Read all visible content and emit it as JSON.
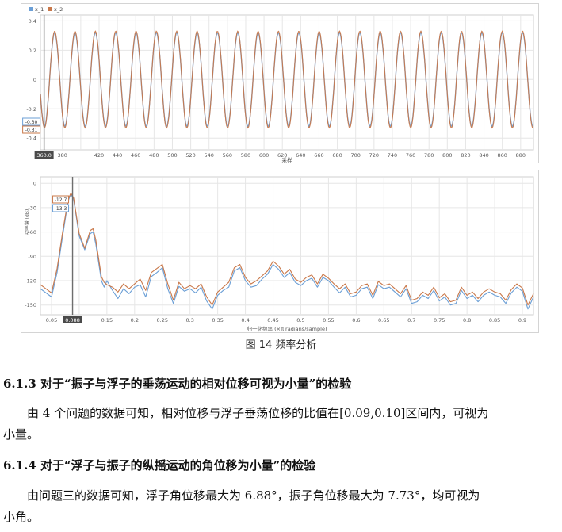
{
  "figure": {
    "caption": "图 14  频率分析",
    "colors": {
      "x_1": "#6b9fd6",
      "x_2": "#c9784a",
      "grid": "#e6e6e6",
      "cursor": "#6e6e6e",
      "cursorTag": "#4a4a4a"
    },
    "time_panel": {
      "legend": [
        "x_1",
        "x_2"
      ],
      "xlabel": "采样",
      "cursor_label": "360.0",
      "markers": [
        "-0.30",
        "-0.31"
      ]
    },
    "freq_panel": {
      "ylabel": "功率谱 (dB)",
      "xlabel": "归一化频率 (×π radians/sample)",
      "cursor_label": "0.088",
      "markers": [
        "-12.7",
        "-13.3"
      ]
    }
  },
  "chart_data": [
    {
      "type": "line",
      "title": "",
      "xlabel": "采样",
      "ylabel": "",
      "xlim": [
        356,
        894
      ],
      "ylim": [
        -0.48,
        0.44
      ],
      "x_ticks": [
        360,
        380,
        400,
        420,
        440,
        460,
        480,
        500,
        520,
        540,
        560,
        580,
        600,
        620,
        640,
        660,
        680,
        700,
        720,
        740,
        760,
        780,
        800,
        820,
        840,
        860,
        880
      ],
      "x_tick_labels": [
        "360",
        "380",
        "",
        "420",
        "440",
        "460",
        "480",
        "500",
        "520",
        "540",
        "560",
        "580",
        "600",
        "620",
        "640",
        "660",
        "680",
        "700",
        "720",
        "740",
        "760",
        "780",
        "800",
        "820",
        "840",
        "860",
        "880"
      ],
      "y_ticks": [
        -0.4,
        -0.2,
        0,
        0.2,
        0.4
      ],
      "y_tick_labels": [
        "-0.4",
        "-0.2",
        "0",
        "0.2",
        "0.4"
      ],
      "series": [
        {
          "name": "x_1",
          "period": 22.2,
          "amplitude": 0.32,
          "phase_zero_at": 366
        },
        {
          "name": "x_2",
          "period": 22.2,
          "amplitude": 0.33,
          "phase_zero_at": 366
        }
      ],
      "cursor_x": 360,
      "legend": "top-left",
      "grid": true
    },
    {
      "type": "line",
      "title": "",
      "xlabel": "归一化频率 (×π radians/sample)",
      "ylabel": "功率谱 (dB)",
      "xlim": [
        0.03,
        0.92
      ],
      "ylim": [
        -162,
        8
      ],
      "x_ticks": [
        0.05,
        0.1,
        0.15,
        0.2,
        0.25,
        0.3,
        0.35,
        0.4,
        0.45,
        0.5,
        0.55,
        0.6,
        0.65,
        0.7,
        0.75,
        0.8,
        0.85,
        0.9
      ],
      "x_tick_labels": [
        "0.05",
        "",
        "0.15",
        "0.2",
        "0.25",
        "0.3",
        "0.35",
        "0.4",
        "0.45",
        "0.5",
        "0.55",
        "0.6",
        "0.65",
        "0.7",
        "0.75",
        "0.8",
        "0.85",
        "0.9"
      ],
      "y_ticks": [
        0,
        -30,
        -60,
        -90,
        -120,
        -150
      ],
      "y_tick_labels": [
        "0",
        "-30",
        "-60",
        "-90",
        "-120",
        "-150"
      ],
      "series": [
        {
          "name": "x_1",
          "x": [
            0.03,
            0.05,
            0.06,
            0.07,
            0.08,
            0.085,
            0.09,
            0.1,
            0.11,
            0.12,
            0.125,
            0.13,
            0.14,
            0.145,
            0.15,
            0.16,
            0.17,
            0.18,
            0.19,
            0.2,
            0.21,
            0.22,
            0.23,
            0.24,
            0.25,
            0.26,
            0.27,
            0.28,
            0.29,
            0.3,
            0.31,
            0.32,
            0.33,
            0.34,
            0.35,
            0.36,
            0.37,
            0.38,
            0.39,
            0.4,
            0.41,
            0.42,
            0.43,
            0.44,
            0.45,
            0.46,
            0.47,
            0.48,
            0.49,
            0.5,
            0.51,
            0.52,
            0.53,
            0.54,
            0.55,
            0.56,
            0.57,
            0.58,
            0.59,
            0.6,
            0.61,
            0.62,
            0.63,
            0.64,
            0.65,
            0.66,
            0.67,
            0.68,
            0.69,
            0.7,
            0.71,
            0.72,
            0.73,
            0.74,
            0.75,
            0.76,
            0.77,
            0.78,
            0.79,
            0.8,
            0.81,
            0.82,
            0.83,
            0.84,
            0.85,
            0.86,
            0.87,
            0.88,
            0.89,
            0.9,
            0.91,
            0.92
          ],
          "y": [
            -130,
            -140,
            -110,
            -65,
            -22,
            -13,
            -20,
            -65,
            -82,
            -62,
            -60,
            -75,
            -120,
            -128,
            -120,
            -132,
            -142,
            -130,
            -136,
            -128,
            -125,
            -140,
            -115,
            -110,
            -104,
            -130,
            -148,
            -127,
            -133,
            -130,
            -135,
            -128,
            -145,
            -155,
            -138,
            -132,
            -128,
            -108,
            -104,
            -120,
            -128,
            -126,
            -118,
            -112,
            -100,
            -106,
            -116,
            -110,
            -122,
            -126,
            -120,
            -117,
            -128,
            -116,
            -120,
            -128,
            -135,
            -128,
            -140,
            -138,
            -130,
            -128,
            -142,
            -125,
            -130,
            -128,
            -134,
            -140,
            -130,
            -148,
            -146,
            -138,
            -142,
            -132,
            -145,
            -140,
            -150,
            -148,
            -132,
            -142,
            -138,
            -146,
            -138,
            -134,
            -138,
            -140,
            -148,
            -135,
            -128,
            -133,
            -155,
            -140
          ]
        },
        {
          "name": "x_2",
          "x": [
            0.03,
            0.05,
            0.06,
            0.07,
            0.08,
            0.085,
            0.09,
            0.1,
            0.11,
            0.12,
            0.125,
            0.13,
            0.14,
            0.145,
            0.15,
            0.16,
            0.17,
            0.18,
            0.19,
            0.2,
            0.21,
            0.22,
            0.23,
            0.24,
            0.25,
            0.26,
            0.27,
            0.28,
            0.29,
            0.3,
            0.31,
            0.32,
            0.33,
            0.34,
            0.35,
            0.36,
            0.37,
            0.38,
            0.39,
            0.4,
            0.41,
            0.42,
            0.43,
            0.44,
            0.45,
            0.46,
            0.47,
            0.48,
            0.49,
            0.5,
            0.51,
            0.52,
            0.53,
            0.54,
            0.55,
            0.56,
            0.57,
            0.58,
            0.59,
            0.6,
            0.61,
            0.62,
            0.63,
            0.64,
            0.65,
            0.66,
            0.67,
            0.68,
            0.69,
            0.7,
            0.71,
            0.72,
            0.73,
            0.74,
            0.75,
            0.76,
            0.77,
            0.78,
            0.79,
            0.8,
            0.81,
            0.82,
            0.83,
            0.84,
            0.85,
            0.86,
            0.87,
            0.88,
            0.89,
            0.9,
            0.91,
            0.92
          ],
          "y": [
            -125,
            -135,
            -105,
            -60,
            -20,
            -12,
            -18,
            -62,
            -80,
            -58,
            -56,
            -70,
            -115,
            -122,
            -125,
            -128,
            -134,
            -124,
            -130,
            -124,
            -118,
            -132,
            -110,
            -105,
            -100,
            -124,
            -144,
            -122,
            -130,
            -126,
            -130,
            -124,
            -140,
            -150,
            -134,
            -128,
            -122,
            -104,
            -100,
            -116,
            -124,
            -120,
            -114,
            -108,
            -96,
            -102,
            -112,
            -106,
            -118,
            -122,
            -116,
            -113,
            -124,
            -112,
            -117,
            -124,
            -130,
            -124,
            -136,
            -134,
            -126,
            -124,
            -138,
            -121,
            -126,
            -124,
            -130,
            -136,
            -126,
            -144,
            -142,
            -134,
            -138,
            -128,
            -141,
            -136,
            -146,
            -144,
            -128,
            -138,
            -134,
            -142,
            -134,
            -130,
            -134,
            -136,
            -144,
            -131,
            -124,
            -129,
            -150,
            -136
          ]
        }
      ],
      "cursor_x": 0.088,
      "legend": "none",
      "grid": true
    }
  ],
  "sections": [
    {
      "heading": "6.1.3 对于“振子与浮子的垂荡运动的相对位移可视为小量”的检验",
      "para_line1": "由 4 个问题的数据可知，相对位移与浮子垂荡位移的比值在[0.09,0.10]区间内，可视为",
      "para_line2": "小量。"
    },
    {
      "heading": "6.1.4 对于“浮子与振子的纵摇运动的角位移为小量”的检验",
      "para_line1": "由问题三的数据可知，浮子角位移最大为 6.88°，振子角位移最大为 7.73°，均可视为",
      "para_line2": "小角。"
    }
  ]
}
